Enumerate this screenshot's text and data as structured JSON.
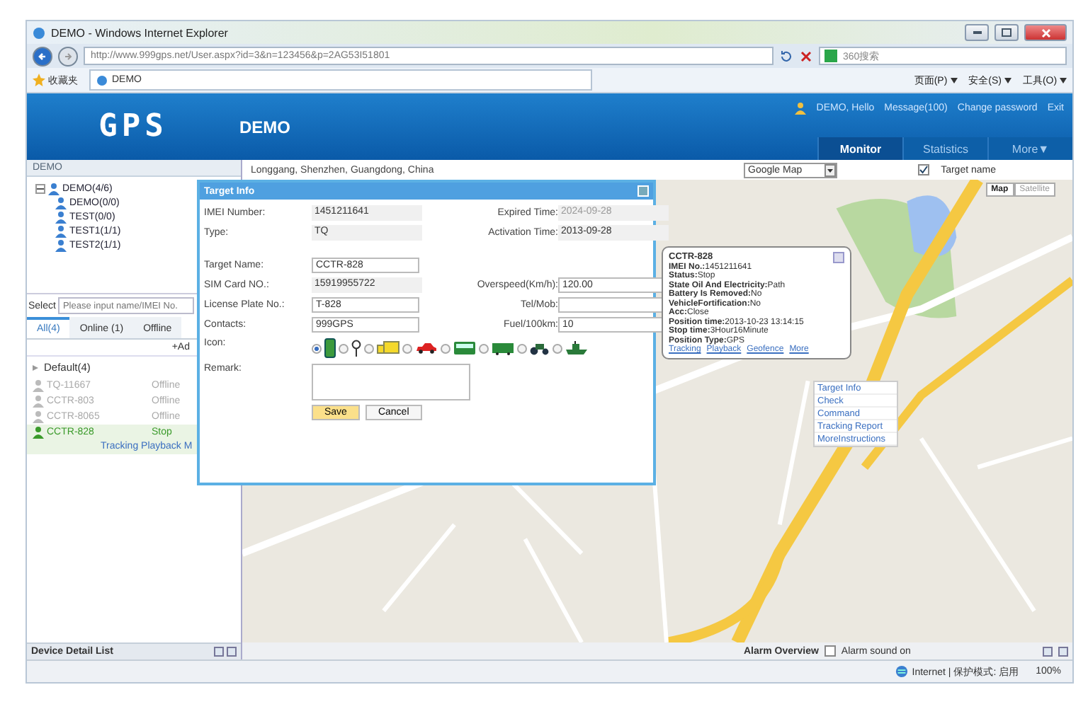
{
  "browser": {
    "title": "DEMO - Windows Internet Explorer",
    "url": "http://www.999gps.net/User.aspx?id=3&n=123456&p=2AG53I51801",
    "search_placeholder": "360搜索",
    "favorites": "收藏夹",
    "tab": "DEMO",
    "commands": [
      "页面(P)",
      "安全(S)",
      "工具(O)"
    ]
  },
  "header": {
    "logo": "GPS",
    "title": "DEMO",
    "user_links": [
      "DEMO, Hello",
      "Message(100)",
      "Change password",
      "Exit"
    ],
    "tabs": [
      {
        "label": "Monitor",
        "selected": true
      },
      {
        "label": "Statistics",
        "selected": false
      },
      {
        "label": "More▼",
        "selected": false
      }
    ]
  },
  "left_panel": {
    "title": "DEMO",
    "tree": [
      {
        "label": "DEMO(4/6)",
        "expanded": true,
        "children": [
          {
            "label": "DEMO(0/0)"
          },
          {
            "label": "TEST(0/0)"
          },
          {
            "label": "TEST1(1/1)"
          },
          {
            "label": "TEST2(1/1)"
          }
        ]
      }
    ],
    "select_label": "Select",
    "search_placeholder": "Please input name/IMEI No.",
    "tabs": [
      {
        "label": "All(4)",
        "selected": true
      },
      {
        "label": "Online (1)",
        "selected": false
      },
      {
        "label": "Offline",
        "selected": false
      }
    ],
    "add": "+Ad",
    "group": "Default(4)",
    "devices": [
      {
        "name": "TQ-11667",
        "status": "Offline",
        "online": false,
        "selected": false
      },
      {
        "name": "CCTR-803",
        "status": "Offline",
        "online": false,
        "selected": false
      },
      {
        "name": "CCTR-8065",
        "status": "Offline",
        "online": false,
        "selected": false
      },
      {
        "name": "CCTR-828",
        "status": "Stop",
        "online": true,
        "selected": true
      }
    ],
    "row_links": "Tracking Playback M",
    "footer": "Device Detail List"
  },
  "map": {
    "address": "Longgang, Shenzhen, Guangdong, China",
    "map_type": "Google Map",
    "target_name": {
      "label": "Target name",
      "checked": true
    },
    "buttons": [
      {
        "label": "Map",
        "selected": true
      },
      {
        "label": "Satellite",
        "selected": false
      }
    ],
    "alarm_title": "Alarm Overview",
    "alarm_sound": {
      "label": "Alarm sound on",
      "checked": false
    }
  },
  "dialog": {
    "title": "Target Info",
    "info": [
      {
        "label": "IMEI Number:",
        "value": "1451211641",
        "label2": "Expired Time:",
        "value2": "2024-09-28"
      },
      {
        "label": "Type:",
        "value": "TQ",
        "label2": "Activation Time:",
        "value2": "2013-09-28"
      }
    ],
    "fields": [
      {
        "label": "Target Name:",
        "value": "CCTR-828",
        "editable": true
      },
      {
        "label": "SIM Card NO.:",
        "value": "15919955722",
        "editable": false,
        "label2": "Overspeed(Km/h):",
        "value2": "120.00"
      },
      {
        "label": "License Plate No.:",
        "value": "T-828",
        "editable": true,
        "label2": "Tel/Mob:"
      },
      {
        "label": "Contacts:",
        "value": "999GPS",
        "editable": true,
        "label2": "Fuel/100km:",
        "value2": "10"
      }
    ],
    "icon_label": "Icon:",
    "icons": [
      {
        "kind": "phone",
        "selected": true
      },
      {
        "kind": "pin",
        "selected": false
      },
      {
        "kind": "truck",
        "selected": false
      },
      {
        "kind": "car",
        "selected": false
      },
      {
        "kind": "bus",
        "selected": false
      },
      {
        "kind": "van",
        "selected": false
      },
      {
        "kind": "tractor",
        "selected": false
      },
      {
        "kind": "boat",
        "selected": false
      }
    ],
    "remark_label": "Remark:",
    "buttons": [
      "Save",
      "Cancel"
    ]
  },
  "popup": {
    "title": "CCTR-828",
    "lines": [
      {
        "label": "IMEI No.:",
        "value": "1451211641"
      },
      {
        "label": "Status:",
        "value": "Stop"
      },
      {
        "label": "State Oil And Electricity:",
        "value": "Path"
      },
      {
        "label": "Battery Is Removed:",
        "value": "No"
      },
      {
        "label": "VehicleFortification:",
        "value": "No"
      },
      {
        "label": "Acc:",
        "value": "Close"
      },
      {
        "label": "Position time:",
        "value": "2013-10-23 13:14:15"
      },
      {
        "label": "Stop time:",
        "value": "3Hour16Minute"
      },
      {
        "label": "Position Type:",
        "value": "GPS"
      }
    ],
    "links": [
      "Tracking",
      "Playback",
      "Geofence",
      "More"
    ]
  },
  "menu": [
    "Target Info",
    "Check",
    "Command",
    "Tracking Report",
    "MoreInstructions"
  ],
  "status_bar": {
    "zone": "Internet | 保护模式: 启用",
    "zoom": "100%"
  }
}
